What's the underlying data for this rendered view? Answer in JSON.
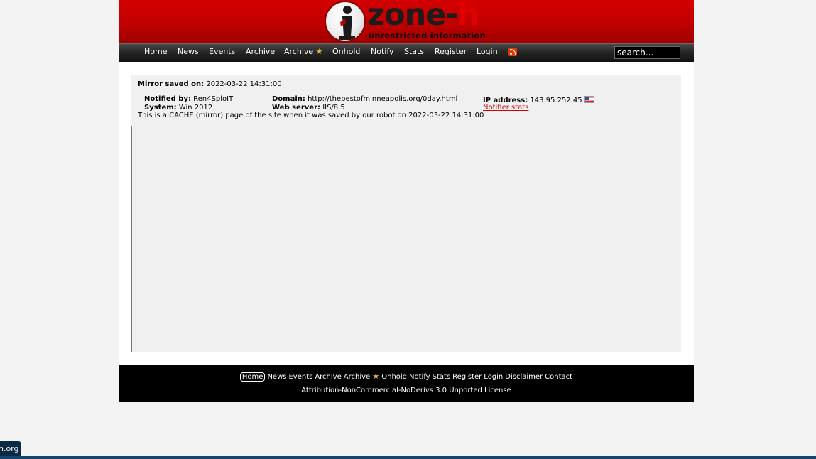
{
  "logo": {
    "word_main": "zone-",
    "word_accent": "h",
    "tagline": "unrestricted information"
  },
  "nav": {
    "items": [
      "Home",
      "News",
      "Events",
      "Archive",
      "Archive",
      "Onhold",
      "Notify",
      "Stats",
      "Register",
      "Login"
    ],
    "search_value": "search..."
  },
  "mirror": {
    "saved_label": "Mirror saved on:",
    "saved_value": "2022-03-22 14:31:00",
    "notified_label": "Notified by:",
    "notified_value": "Ren4SploIT",
    "domain_label": "Domain:",
    "domain_value": "http://thebestofminneapolis.org/0day.html",
    "ip_label": "IP address:",
    "ip_value": "143.95.252.45",
    "system_label": "System:",
    "system_value": "Win 2012",
    "webserver_label": "Web server:",
    "webserver_value": "IIS/8.5",
    "notifier_stats": "Notifier stats",
    "cache_note": "This is a CACHE (mirror) page of the site when it was saved by our robot on 2022-03-22 14:31:00"
  },
  "footer": {
    "links": [
      "Home",
      "News",
      "Events",
      "Archive",
      "Archive",
      "Onhold",
      "Notify",
      "Stats",
      "Register",
      "Login",
      "Disclaimer",
      "Contact"
    ],
    "license": "Attribution-NonCommercial-NoDerivs 3.0 Unported License"
  },
  "corner_tag": "n.org",
  "icons": {
    "rss": "rss-icon",
    "star": "star-icon",
    "flag": "us-flag-icon"
  },
  "colors": {
    "header_red": "#c00000",
    "link_red": "#cc0000",
    "footer_bg": "#000000"
  }
}
